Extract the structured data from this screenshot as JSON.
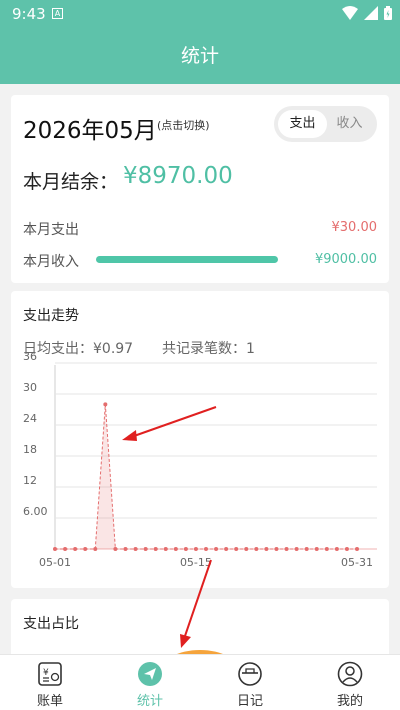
{
  "status_bar": {
    "time": "9:43",
    "notif_icon": "A"
  },
  "header": {
    "title": "统计"
  },
  "summary": {
    "month": "2026年05月",
    "month_hint": "(点击切换)",
    "toggle": {
      "expense": "支出",
      "income": "收入",
      "selected": "支出"
    },
    "balance_label": "本月结余：",
    "balance_value": "¥8970.00",
    "expense_label": "本月支出",
    "expense_value": "¥30.00",
    "income_label": "本月收入",
    "income_value": "¥9000.00"
  },
  "trend": {
    "title": "支出走势",
    "avg_label": "日均支出：¥0.97",
    "count_label": "共记录笔数：1"
  },
  "chart_data": {
    "type": "area",
    "title": "",
    "xlabel": "",
    "ylabel": "",
    "x_ticks": [
      "05-01",
      "05-15",
      "05-31"
    ],
    "y_ticks": [
      "6.00",
      "12",
      "18",
      "24",
      "30",
      "36"
    ],
    "ylim": [
      0,
      36
    ],
    "grid": true,
    "series": [
      {
        "values": [
          0,
          0,
          0,
          0,
          0,
          28,
          0,
          0,
          0,
          0,
          0,
          0,
          0,
          0,
          0,
          0,
          0,
          0,
          0,
          0,
          0,
          0,
          0,
          0,
          0,
          0,
          0,
          0,
          0,
          0,
          0
        ],
        "color": "#e46d6d"
      }
    ]
  },
  "ratio": {
    "title": "支出占比"
  },
  "tabs": [
    {
      "label": "账单",
      "icon": "ledger-icon"
    },
    {
      "label": "统计",
      "icon": "send-icon"
    },
    {
      "label": "日记",
      "icon": "notebook-icon"
    },
    {
      "label": "我的",
      "icon": "user-icon"
    }
  ],
  "colors": {
    "accent": "#5ec2aa",
    "expense": "#e46d6d",
    "income": "#4fbfa4"
  }
}
